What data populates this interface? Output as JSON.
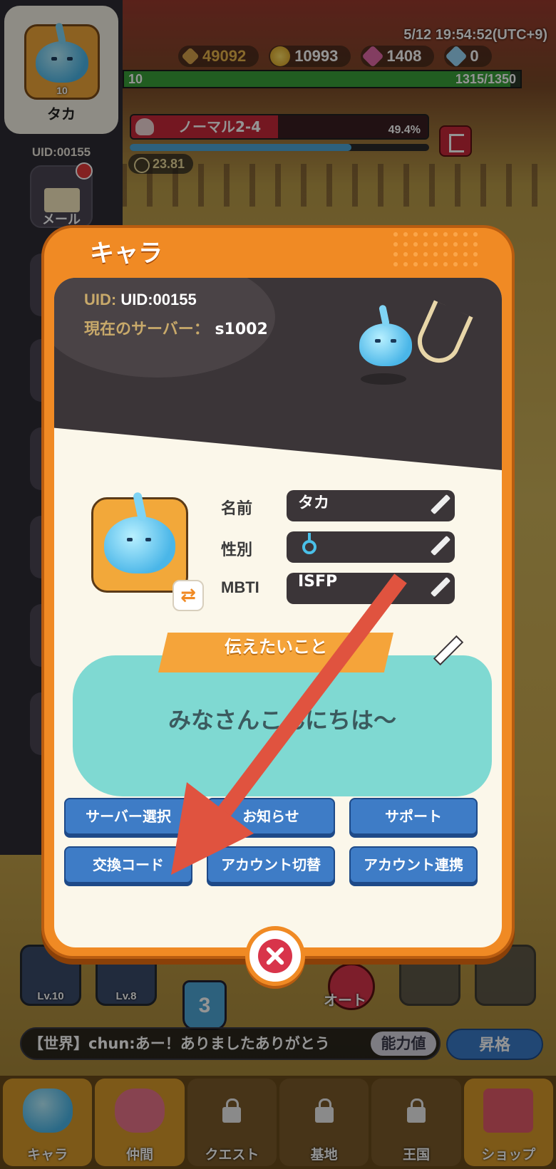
{
  "hud": {
    "datetime": "5/12 19:54:52(UTC+9)",
    "power": "49092",
    "gold": "10993",
    "gems": "1408",
    "diamonds": "0",
    "xp_level": "10",
    "xp_value": "1315/1350",
    "xp_fraction": 0.974,
    "stage_name": "ノーマル2-4",
    "stage_progress": "49.4%",
    "timer": "23.81"
  },
  "sidebar": {
    "level": "10",
    "name": "タカ",
    "uid": "UID:00155",
    "mail_label": "メール"
  },
  "modal": {
    "title": "キャラ",
    "uid_key": "UID:",
    "uid_value": "UID:00155",
    "server_key": "現在のサーバー：",
    "server_value": "s1002",
    "fields": {
      "name_label": "名前",
      "name_value": "タカ",
      "gender_label": "性別",
      "gender_icon": "male-icon",
      "mbti_label": "MBTI",
      "mbti_value": "ISFP"
    },
    "message_title": "伝えたいこと",
    "message_text": "みなさんこんにちは～",
    "buttons": [
      "サーバー選択",
      "お知らせ",
      "サポート",
      "交換コード",
      "アカウント切替",
      "アカウント連携"
    ]
  },
  "lower": {
    "skill1_lv": "Lv.10",
    "skill2_lv": "Lv.8",
    "potion_count": "3",
    "auto_label": "オート",
    "chat_text": "【世界】chun:あー！ありましたありがとう",
    "chat_button": "能力値",
    "promote_button": "昇格"
  },
  "nav": [
    {
      "label": "キャラ",
      "icon": "slime-icon"
    },
    {
      "label": "仲間",
      "icon": "companion-icon"
    },
    {
      "label": "クエスト",
      "icon": "lock-icon"
    },
    {
      "label": "基地",
      "icon": "lock-icon"
    },
    {
      "label": "王国",
      "icon": "lock-icon"
    },
    {
      "label": "ショップ",
      "icon": "shop-icon"
    }
  ],
  "colors": {
    "modal_orange": "#f08a24",
    "button_blue": "#3e7cc6",
    "arrow_red": "#e0533f"
  }
}
